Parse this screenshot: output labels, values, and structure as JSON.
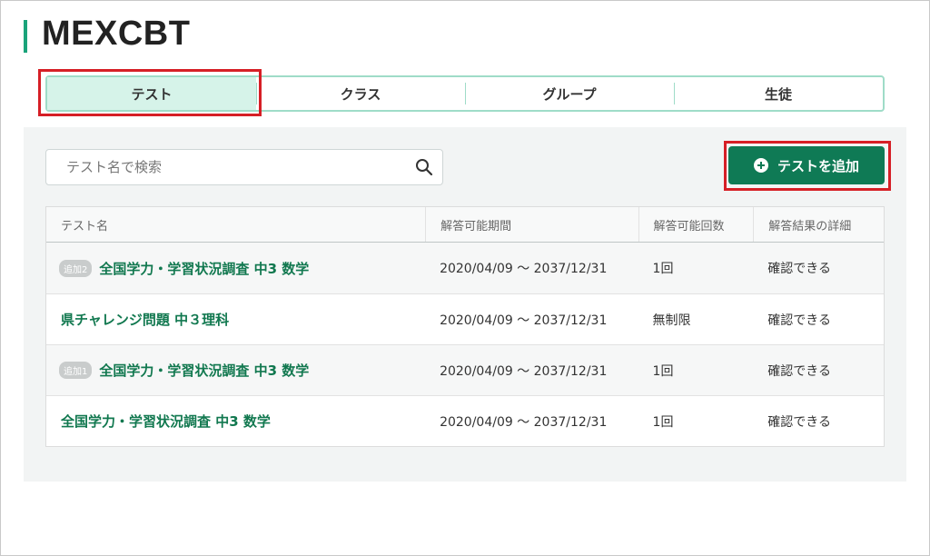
{
  "app_title": "MEXCBT",
  "tabs": [
    {
      "label": "テスト"
    },
    {
      "label": "クラス"
    },
    {
      "label": "グループ"
    },
    {
      "label": "生徒"
    }
  ],
  "search": {
    "placeholder": "テスト名で検索",
    "value": ""
  },
  "add_button": {
    "label": "テストを追加"
  },
  "table": {
    "headers": [
      "テスト名",
      "解答可能期間",
      "解答可能回数",
      "解答結果の詳細"
    ],
    "rows": [
      {
        "badge": "追加2",
        "name": "全国学力・学習状況調査 中3 数学",
        "period": "2020/04/09 〜 2037/12/31",
        "attempts": "1回",
        "detail": "確認できる"
      },
      {
        "badge": "",
        "name": "県チャレンジ問題 中３理科",
        "period": "2020/04/09 〜 2037/12/31",
        "attempts": "無制限",
        "detail": "確認できる"
      },
      {
        "badge": "追加1",
        "name": "全国学力・学習状況調査 中3 数学",
        "period": "2020/04/09 〜 2037/12/31",
        "attempts": "1回",
        "detail": "確認できる"
      },
      {
        "badge": "",
        "name": "全国学力・学習状況調査 中3 数学",
        "period": "2020/04/09 〜 2037/12/31",
        "attempts": "1回",
        "detail": "確認できる"
      }
    ]
  },
  "colors": {
    "accent": "#0f7a55",
    "tab_active": "#d6f3e9",
    "highlight": "#d61f26"
  },
  "icons": {
    "search": "search-icon",
    "add": "plus-circle-icon"
  }
}
